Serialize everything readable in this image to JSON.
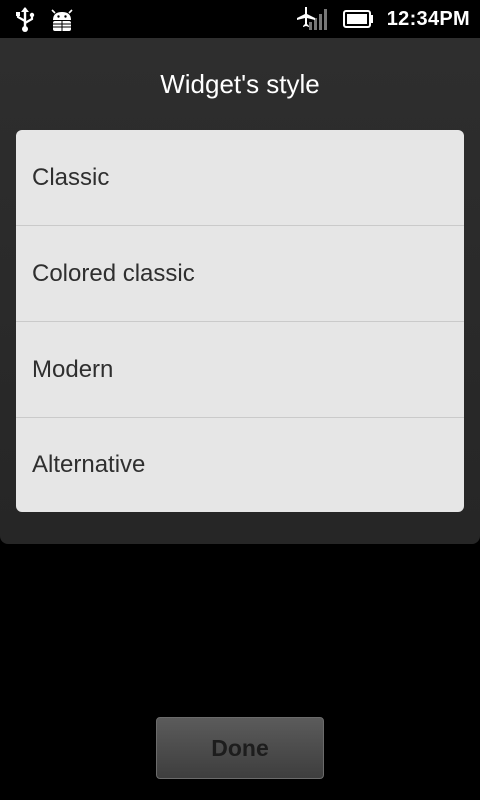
{
  "status_bar": {
    "time": "12:34PM",
    "icons": [
      "usb-icon",
      "android-debug-icon",
      "airplane-mode-icon",
      "signal-icon",
      "battery-icon"
    ]
  },
  "dialog": {
    "title": "Widget's style",
    "options": [
      {
        "label": "Classic"
      },
      {
        "label": "Colored classic"
      },
      {
        "label": "Modern"
      },
      {
        "label": "Alternative"
      }
    ]
  },
  "done_label": "Done",
  "colors": {
    "dialog_background": "#2a2a2a",
    "list_background": "#e6e6e6",
    "list_text": "#2f2f2f",
    "button_background": "#4b4b4b"
  }
}
